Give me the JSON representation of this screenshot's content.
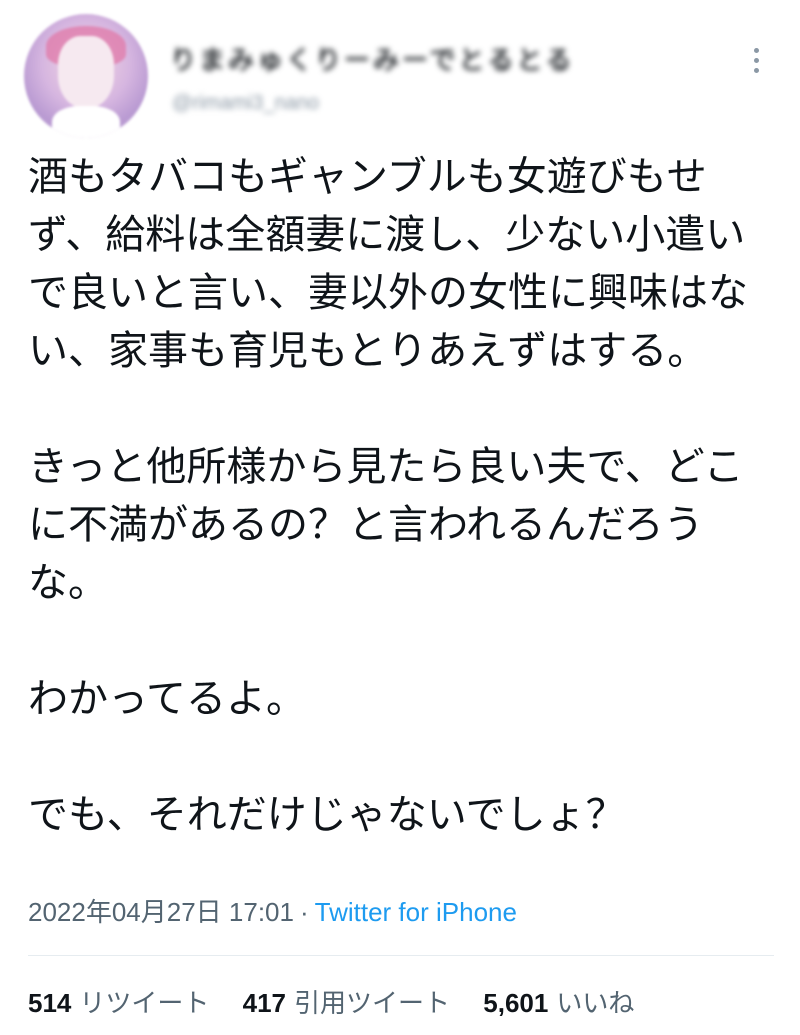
{
  "author": {
    "display_name": "りまみゅくりーみーでとるとる",
    "handle": "@rimami3_nano"
  },
  "tweet": {
    "text": "酒もタバコもギャンブルも女遊びもせず、給料は全額妻に渡し、少ない小遣いで良いと言い、妻以外の女性に興味はない、家事も育児もとりあえずはする。\n\nきっと他所様から見たら良い夫で、どこに不満があるの？と言われるんだろうな。\n\nわかってるよ。\n\nでも、それだけじゃないでしょ？",
    "timestamp": "2022年04月27日 17:01",
    "separator": "·",
    "source": "Twitter for iPhone"
  },
  "stats": {
    "retweets_count": "514",
    "retweets_label": "リツイート",
    "quotes_count": "417",
    "quotes_label": "引用ツイート",
    "likes_count": "5,601",
    "likes_label": "いいね"
  },
  "colors": {
    "link": "#1d9bf0",
    "secondary_text": "#536471",
    "primary_text": "#0f1419"
  },
  "icons": {
    "more": "more-vertical-icon"
  }
}
